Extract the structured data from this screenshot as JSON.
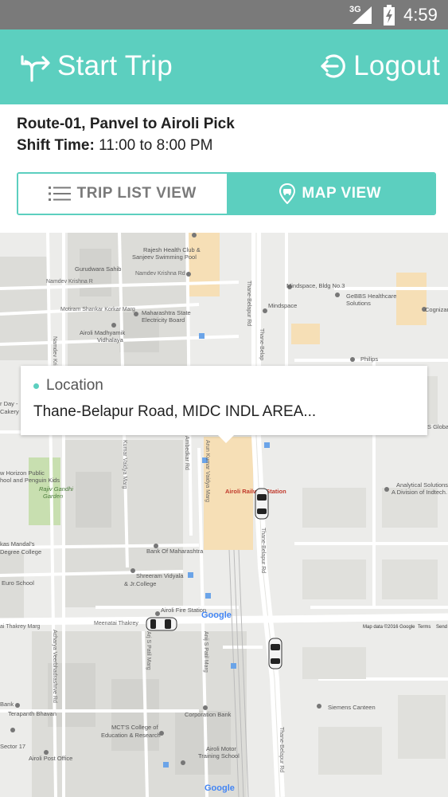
{
  "status_bar": {
    "network": "3G",
    "time": "4:59"
  },
  "app_bar": {
    "start_trip_label": "Start Trip",
    "logout_label": "Logout",
    "accent": "#5ccfbf"
  },
  "route": {
    "title": "Route-01, Panvel to Airoli Pick",
    "shift_label": "Shift Time:",
    "shift_value": "11:00 to 8:00 PM"
  },
  "view_toggle": {
    "list_label": "TRIP LIST VIEW",
    "map_label": "MAP VIEW",
    "selected": "MAP VIEW"
  },
  "popup": {
    "header": "Location",
    "address": "Thane-Belapur Road, MIDC INDL AREA..."
  },
  "map": {
    "labels": {
      "rajesh": "Rajesh Health Club &",
      "sanjeev": "Sanjeev Swimming Pool",
      "gurudwara": "Gurudwara Sahib",
      "namdev_krishna": "Namdev Krishna R",
      "namdev_krishna2": "Namdev Krishna Rd",
      "motiram": "Motiram Shankar Korkar Marg",
      "msedb1": "Maharashtra State",
      "msedb2": "Electricity Board",
      "airoli_m1": "Airoli Madhyamik",
      "airoli_m2": "Vidhalaya",
      "mindspace_bldg": "Mindspace, Bldg No.3",
      "gebbs1": "GeBBS Healthcare",
      "gebbs2": "Solutions",
      "cognizant": "Cognizan",
      "mindspace": "Mindspace",
      "philips": "Philips",
      "thane_bel_1": "Thane-Belapur Rd",
      "thane_bel_2": "Thane-Belap",
      "thane_bel_3": "Thane-Belapur Rd",
      "thane_bel_4": "Thane-Belapur Rd",
      "namdev_left": "Namdev Kri",
      "day1": "r Day -",
      "day2": "Cakery",
      "horizon1": "w Horizon Public",
      "horizon2": "hool and Penguin Kids",
      "rajiv1": "Rajiv Gandhi",
      "rajiv2": "Garden",
      "kumar_marg": "Kumar Vaidya Marg",
      "amb_marg": "Ambedkar Rd",
      "arun_kumar": "Arun Kumar Vaidya Marg",
      "airoli_rly": "Airoli Railway Station",
      "s_global": "S Global",
      "analytical1": "Analytical Solutions",
      "analytical2": "A Division of Indtech.",
      "kas1": "kas Mandal's",
      "kas2": "Degree College",
      "bom": "Bank Of Maharashtra",
      "shreeram1": "Shreeram Vidyala",
      "shreeram2": "& Jr.College",
      "euro": "Euro School",
      "fire": "Airoli Fire Station",
      "thakrey_l": "ai Thakrey Marg",
      "thakrey": "Meenatai Thakrey",
      "mapdata": "Map data ©2016 Google",
      "terms": "Terms",
      "send": "Send",
      "veer": "Acharya Veerbhadrashrve Rd",
      "arj1": "Arj S Patil Marg",
      "arj2": "Anij S Patil Marg",
      "bank_l": "Bank",
      "terapanth": "Terapanth Bhavan",
      "corp_bank": "Corporation Bank",
      "siemens": "Siemens Canteen",
      "mcts1": "MCT'S College of",
      "mcts2": "Education & Research",
      "sector17": "Sector 17",
      "post": "Airoli Post Office",
      "motor1": "Airoli Motor",
      "motor2": "Training School",
      "google": "Google"
    }
  }
}
